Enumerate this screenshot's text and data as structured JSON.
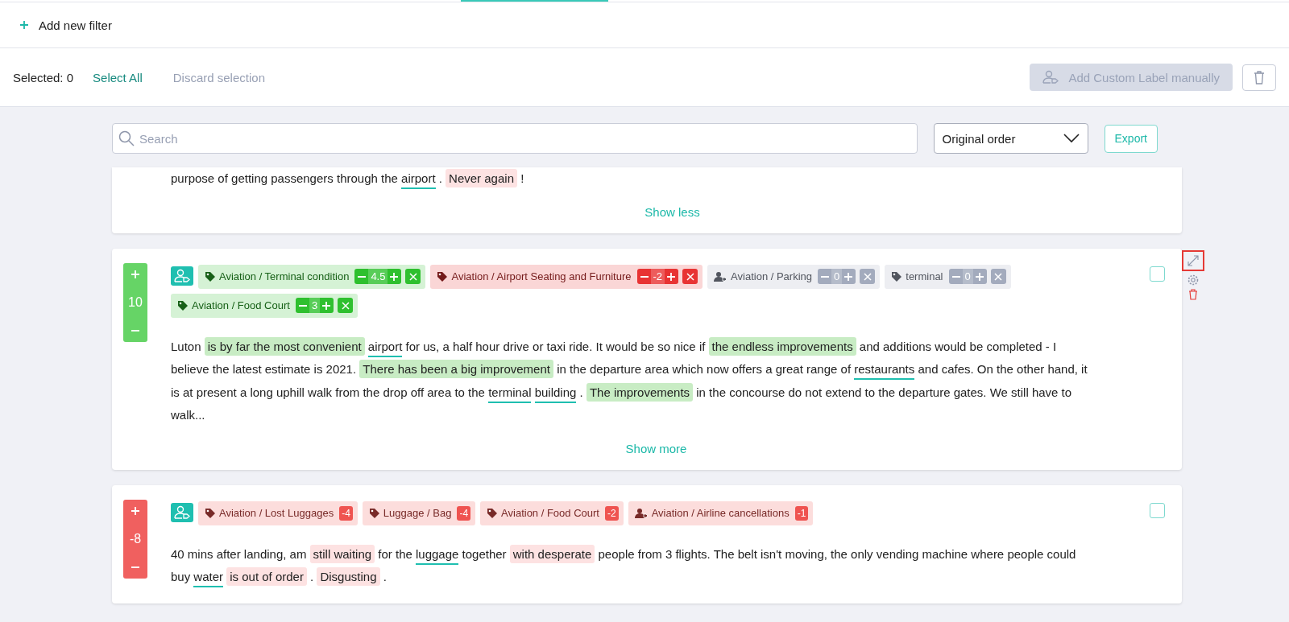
{
  "filter_bar": {
    "add_label": "Add new filter"
  },
  "selection_bar": {
    "selected_text": "Selected: 0",
    "select_all": "Select All",
    "discard": "Discard selection",
    "custom_label_button": {
      "label": "Add Custom Label manually",
      "disabled": true
    }
  },
  "toolbar": {
    "search": {
      "placeholder": "Search"
    },
    "sort": {
      "value": "Original order"
    },
    "export": "Export"
  },
  "reviews": [
    {
      "kind": "partial",
      "text": [
        {
          "kind": "plain",
          "text": "purpose of getting passengers through the"
        },
        {
          "kind": "keyword",
          "text": "airport"
        },
        {
          "kind": "plain",
          "text": "."
        },
        {
          "kind": "negative",
          "text": "Never again"
        },
        {
          "kind": "plain",
          "text": "!"
        }
      ],
      "toggle": "Show less"
    },
    {
      "kind": "editable",
      "score": "10",
      "color": "#66d466",
      "checked": false,
      "show_tools": true,
      "expand_highlighted": true,
      "tags": [
        {
          "kind": "topic",
          "color": "#2ec02e",
          "label": "Aviation / Terminal condition",
          "score": "4.5"
        },
        {
          "kind": "topic",
          "color": "#e83333",
          "label": "Aviation / Airport Seating and Furniture",
          "score": "-2"
        },
        {
          "kind": "person",
          "color": "#a3abbd",
          "label": "Aviation / Parking",
          "score": "0"
        },
        {
          "kind": "topic",
          "color": "#a3abbd",
          "label": "terminal",
          "score": "0"
        },
        {
          "kind": "topic",
          "color": "#2ec02e",
          "label": "Aviation / Food Court",
          "score": "3"
        }
      ],
      "text": [
        {
          "kind": "plain",
          "text": "Luton"
        },
        {
          "kind": "positive",
          "text": "is by far the most convenient"
        },
        {
          "kind": "keyword",
          "text": "airport"
        },
        {
          "kind": "plain",
          "text": "for us, a half hour drive or taxi ride. It would be so nice if"
        },
        {
          "kind": "positive",
          "text": "the endless improvements"
        },
        {
          "kind": "plain",
          "text": "and additions would be completed - I believe the latest estimate is 2021."
        },
        {
          "kind": "positive",
          "text": "There has been a big improvement"
        },
        {
          "kind": "plain",
          "text": "in the departure area which now offers a great range of"
        },
        {
          "kind": "keyword",
          "text": "restaurants"
        },
        {
          "kind": "plain",
          "text": "and cafes. On the other hand, it is at present a long uphill walk from the drop off area to the"
        },
        {
          "kind": "keyword",
          "text": "terminal"
        },
        {
          "kind": "keyword",
          "text": "building"
        },
        {
          "kind": "plain",
          "text": "."
        },
        {
          "kind": "positive",
          "text": "The improvements"
        },
        {
          "kind": "plain",
          "text": "in the concourse do not extend to the departure gates. We still have to walk..."
        }
      ],
      "toggle": "Show more"
    },
    {
      "kind": "scored",
      "score": "-8",
      "color": "#f0605f",
      "checked": false,
      "show_tools": false,
      "tags": [
        {
          "kind": "topic",
          "color": "#ef5350",
          "label": "Aviation / Lost Luggages",
          "score": "-4"
        },
        {
          "kind": "topic",
          "color": "#ef5350",
          "label": "Luggage / Bag",
          "score": "-4"
        },
        {
          "kind": "topic",
          "color": "#ef5350",
          "label": "Aviation / Food Court",
          "score": "-2"
        },
        {
          "kind": "person",
          "color": "#ef5350",
          "label": "Aviation / Airline cancellations",
          "score": "-1"
        }
      ],
      "text": [
        {
          "kind": "plain",
          "text": "40 mins after landing, am"
        },
        {
          "kind": "negative",
          "text": "still waiting"
        },
        {
          "kind": "plain",
          "text": "for the"
        },
        {
          "kind": "keyword",
          "text": "luggage"
        },
        {
          "kind": "plain",
          "text": "together"
        },
        {
          "kind": "negative",
          "text": "with desperate"
        },
        {
          "kind": "plain",
          "text": "people from 3 flights. The belt isn't moving, the only vending machine where people could buy"
        },
        {
          "kind": "keyword",
          "text": "water"
        },
        {
          "kind": "negative",
          "text": "is out of order"
        },
        {
          "kind": "plain",
          "text": "."
        },
        {
          "kind": "negative",
          "text": "Disgusting"
        },
        {
          "kind": "plain",
          "text": "."
        }
      ]
    }
  ]
}
